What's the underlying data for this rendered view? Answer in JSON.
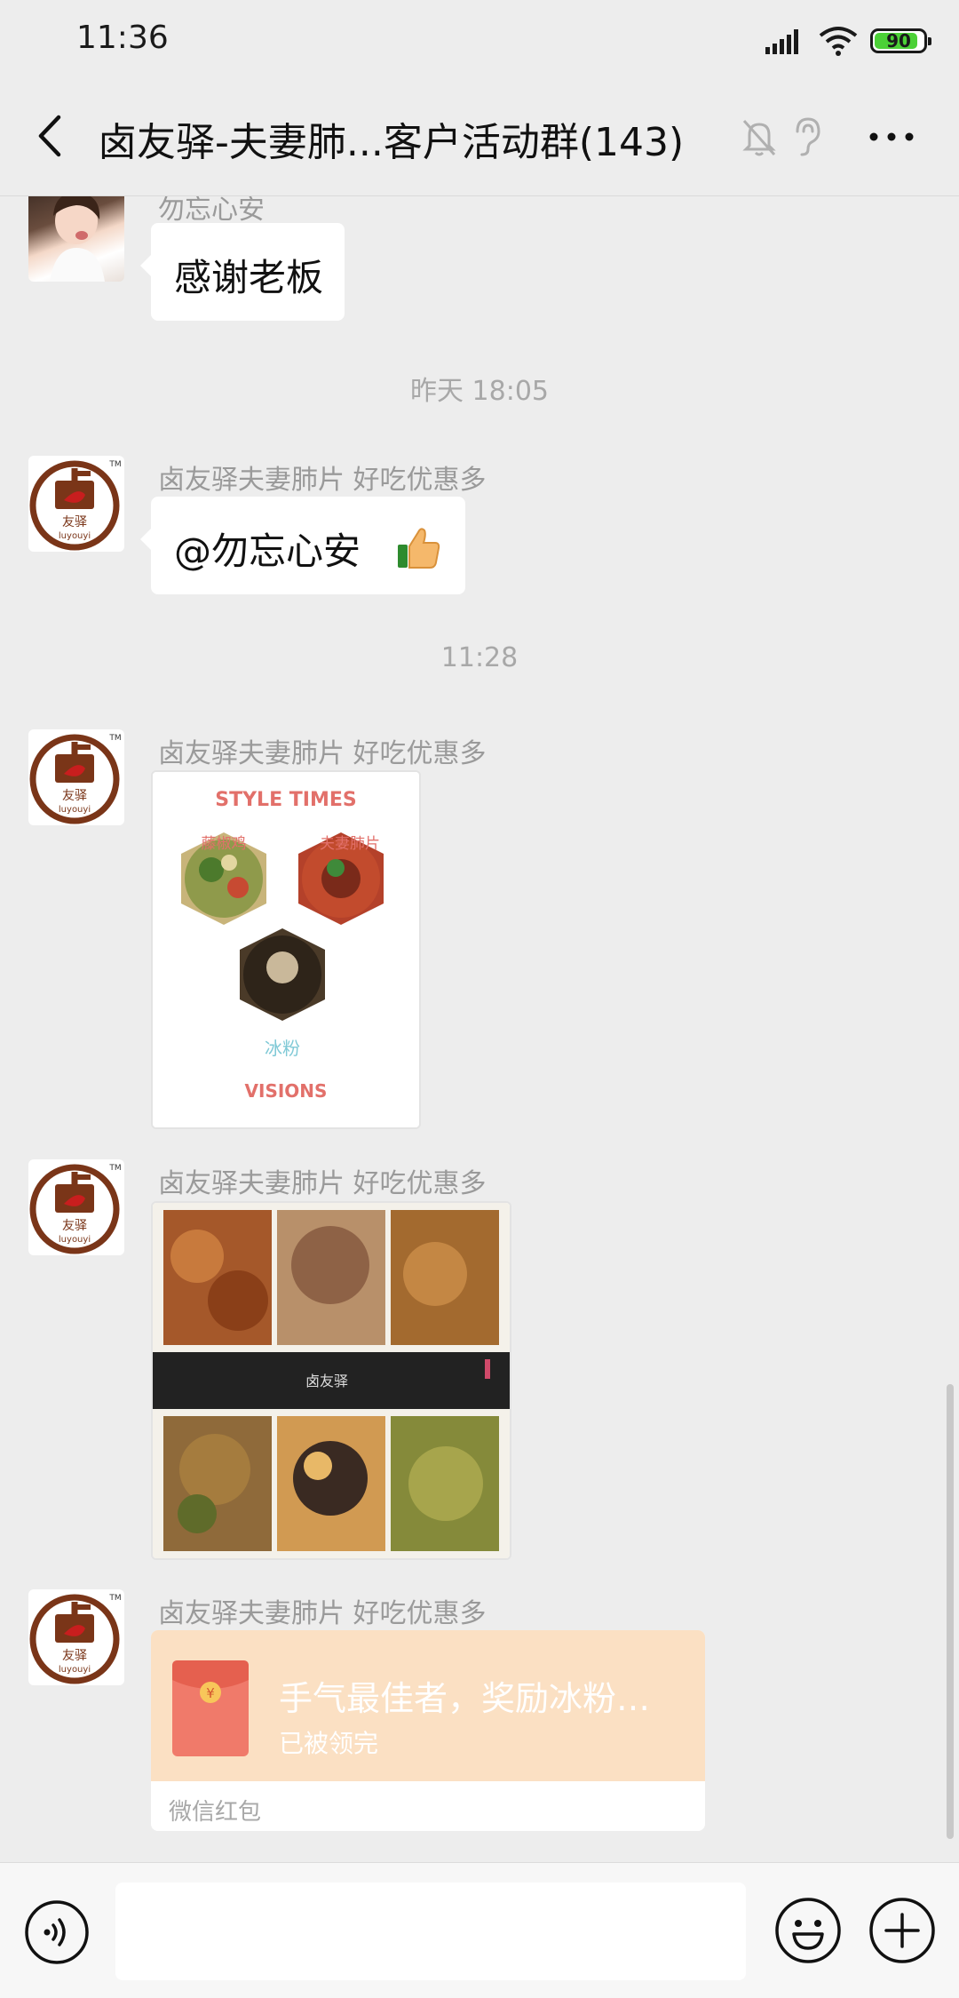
{
  "status_bar": {
    "time": "11:36",
    "battery_level": "90",
    "battery_fraction": 0.9,
    "battery_color": "#4cd137"
  },
  "header": {
    "title": "卤友驿-夫妻肺...客户活动群(143)",
    "icons": [
      "back-arrow-icon",
      "mute-bell-icon",
      "earpiece-icon",
      "more-dots-icon"
    ]
  },
  "chat": {
    "messages": [
      {
        "type": "text",
        "sender": "勿忘心安",
        "avatar": "girl-avatar",
        "text": "感谢老板"
      },
      {
        "type": "timestamp",
        "text": "昨天 18:05"
      },
      {
        "type": "text",
        "sender": "卤友驿夫妻肺片 好吃优惠多",
        "avatar": "luyouyi-logo",
        "text": "@勿忘心安",
        "emoji": "thumbs-up-icon"
      },
      {
        "type": "timestamp",
        "text": "11:28"
      },
      {
        "type": "image",
        "sender": "卤友驿夫妻肺片 好吃优惠多",
        "avatar": "luyouyi-logo",
        "poster": {
          "top_text": "STYLE TIMES",
          "bottom_text": "VISIONS",
          "dish_1": "藤椒鸡",
          "dish_2": "夫妻肺片",
          "dish_3": "冰粉"
        }
      },
      {
        "type": "image",
        "sender": "卤友驿夫妻肺片 好吃优惠多",
        "avatar": "luyouyi-logo",
        "banner_text": "卤友驿"
      },
      {
        "type": "red_packet",
        "sender": "卤友驿夫妻肺片 好吃优惠多",
        "avatar": "luyouyi-logo",
        "title": "手气最佳者，奖励冰粉…",
        "status": "已被领完",
        "footer": "微信红包",
        "envelope_symbol": "¥"
      }
    ]
  },
  "logo": {
    "tm": "TM",
    "line1": "友驿",
    "line2": "luyouyi"
  },
  "input_bar": {
    "placeholder": "",
    "icons": [
      "voice-icon",
      "emoji-icon",
      "plus-icon"
    ]
  },
  "colors": {
    "background": "#ededed",
    "bubble": "#ffffff",
    "red_packet": "#fbe0c3",
    "logo_brown": "#7a3518",
    "logo_red": "#c81e1e"
  }
}
